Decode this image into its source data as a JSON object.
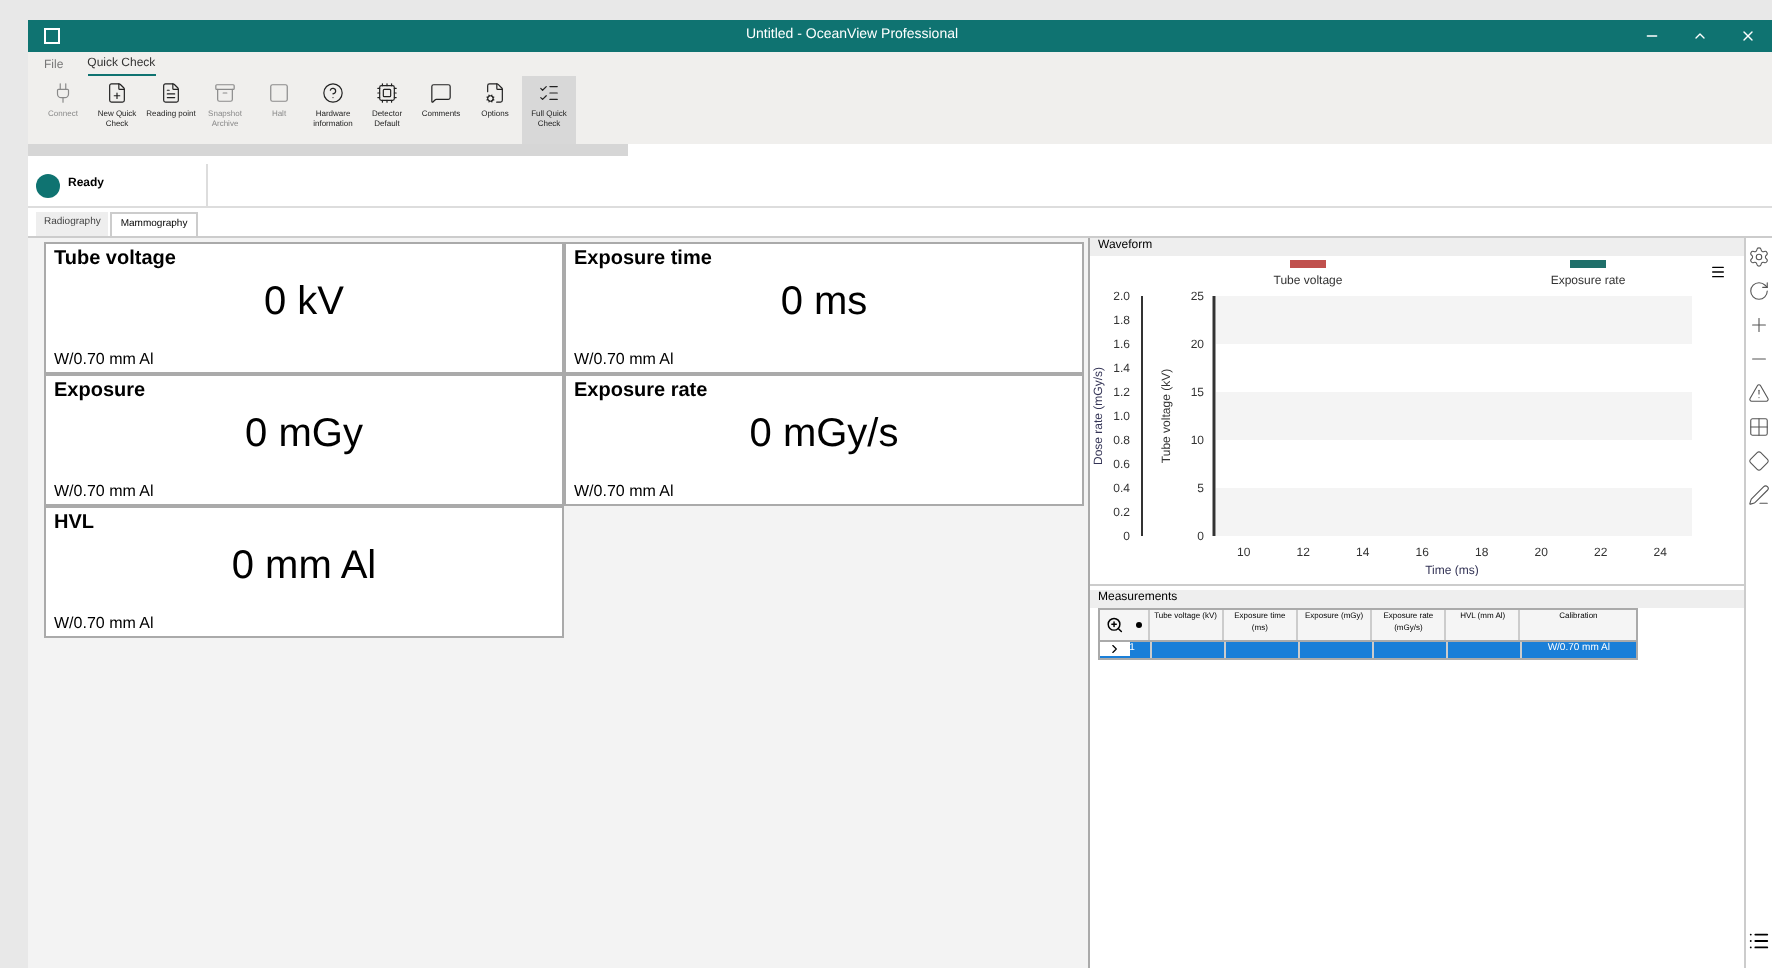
{
  "window": {
    "title": "Untitled - OceanView Professional"
  },
  "menu": [
    {
      "label": "File",
      "selected": false
    },
    {
      "label": "Quick Check",
      "selected": true
    }
  ],
  "toolbar": [
    {
      "label": "Connect",
      "disabled": true,
      "selected": false
    },
    {
      "label": "New Quick Check",
      "disabled": false,
      "selected": false
    },
    {
      "label": "Reading point",
      "disabled": false,
      "selected": false
    },
    {
      "label": "Snapshot Archive",
      "disabled": true,
      "selected": false
    },
    {
      "label": "Halt",
      "disabled": true,
      "selected": false
    },
    {
      "label": "Hardware information",
      "disabled": false,
      "selected": false
    },
    {
      "label": "Detector Default",
      "disabled": false,
      "selected": false
    },
    {
      "label": "Comments",
      "disabled": false,
      "selected": false
    },
    {
      "label": "Options",
      "disabled": false,
      "selected": false
    },
    {
      "label": "Full Quick Check",
      "disabled": false,
      "selected": true
    }
  ],
  "status": {
    "label": "Ready"
  },
  "tabs": [
    {
      "label": "Radiography",
      "selected": false
    },
    {
      "label": "Mammography",
      "selected": true
    }
  ],
  "readings": [
    {
      "title": "Tube voltage",
      "value": "0 kV",
      "filter": "W/0.70 mm Al"
    },
    {
      "title": "Exposure time",
      "value": "0 ms",
      "filter": "W/0.70 mm Al"
    },
    {
      "title": "Exposure",
      "value": "0 mGy",
      "filter": "W/0.70 mm Al"
    },
    {
      "title": "Exposure rate",
      "value": "0 mGy/s",
      "filter": "W/0.70 mm Al"
    },
    {
      "title": "HVL",
      "value": "0 mm Al",
      "filter": "W/0.70 mm Al"
    }
  ],
  "waveform": {
    "title": "Waveform",
    "secondary_axis": {
      "label": "Dose rate (mGy/s)",
      "ticks": [
        "2.0",
        "1.8",
        "1.6",
        "1.4",
        "1.2",
        "1.0",
        "0.8",
        "0.6",
        "0.4",
        "0.2",
        "0"
      ]
    },
    "chart_data": {
      "type": "line",
      "x": [
        10,
        12,
        14,
        16,
        18,
        20,
        22,
        24
      ],
      "xlabel": "Time (ms)",
      "ylabel": "Tube voltage (kV)",
      "series": [
        {
          "name": "Tube voltage",
          "color": "#c0504d",
          "values": [
            null,
            null,
            null,
            null,
            null,
            null,
            null,
            null
          ]
        },
        {
          "name": "Exposure rate",
          "color": "#1f6f6a",
          "values": [
            null,
            null,
            null,
            null,
            null,
            null,
            null,
            null
          ]
        }
      ],
      "ylim": [
        0,
        25
      ],
      "yticks": [
        0,
        5,
        10,
        15,
        20,
        25
      ]
    }
  },
  "measurements": {
    "title": "Measurements",
    "columns": [
      "Tube voltage (kV)",
      "Exposure time (ms)",
      "Exposure (mGy)",
      "Exposure rate (mGy/s)",
      "HVL (mm Al)",
      "Calibration"
    ],
    "rows": [
      {
        "index": "1",
        "cells": [
          "",
          "",
          "",
          "",
          "",
          "W/0.70 mm Al"
        ],
        "selected": true
      }
    ]
  }
}
